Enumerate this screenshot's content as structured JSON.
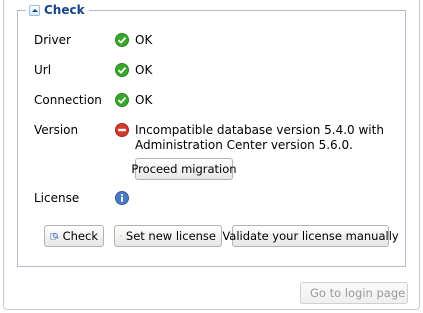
{
  "section": {
    "title": "Check"
  },
  "rows": {
    "driver": {
      "label": "Driver",
      "status": "OK"
    },
    "url": {
      "label": "Url",
      "status": "OK"
    },
    "connection": {
      "label": "Connection",
      "status": "OK"
    },
    "version": {
      "label": "Version",
      "message_line1": "Incompatible database version 5.4.0 with",
      "message_line2": "Administration Center version 5.6.0.",
      "action_label": "Proceed migration"
    },
    "license": {
      "label": "License"
    }
  },
  "buttons": {
    "check": "Check",
    "set_license": "Set new license",
    "validate_license": "Validate your license manually",
    "login": "Go to login page"
  },
  "icons": {
    "ok": "check-circle-icon",
    "error": "error-circle-icon",
    "info": "info-circle-icon",
    "check": "check-magnifier-icon",
    "key": "key-icon",
    "login": "login-page-icon"
  },
  "colors": {
    "ok": "#3aa52e",
    "error": "#d23a2e",
    "info": "#4a7bc0",
    "legend": "#15428b"
  }
}
